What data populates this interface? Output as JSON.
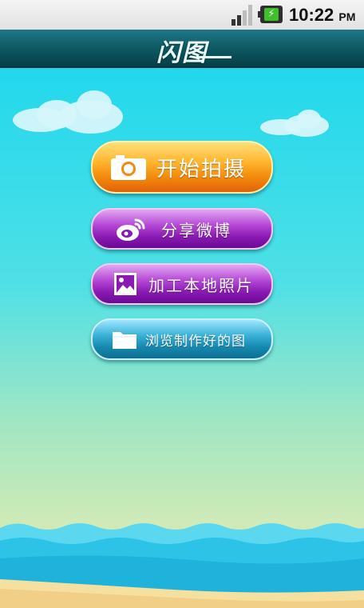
{
  "status_bar": {
    "time": "10:22",
    "ampm": "PM"
  },
  "title_bar": {
    "title": "闪图"
  },
  "buttons": {
    "shoot": "开始拍摄",
    "share_weibo": "分享微博",
    "edit_local": "加工本地照片",
    "browse": "浏览制作好的图"
  },
  "colors": {
    "title_bar": "#0d5963",
    "shoot_button": "#f28a0c",
    "purple_button": "#8b1ab4",
    "blue_button": "#1689b0",
    "sky": "#22d8ec"
  },
  "icons": {
    "shoot": "camera-icon",
    "share_weibo": "weibo-icon",
    "edit_local": "picture-icon",
    "browse": "folder-icon"
  }
}
